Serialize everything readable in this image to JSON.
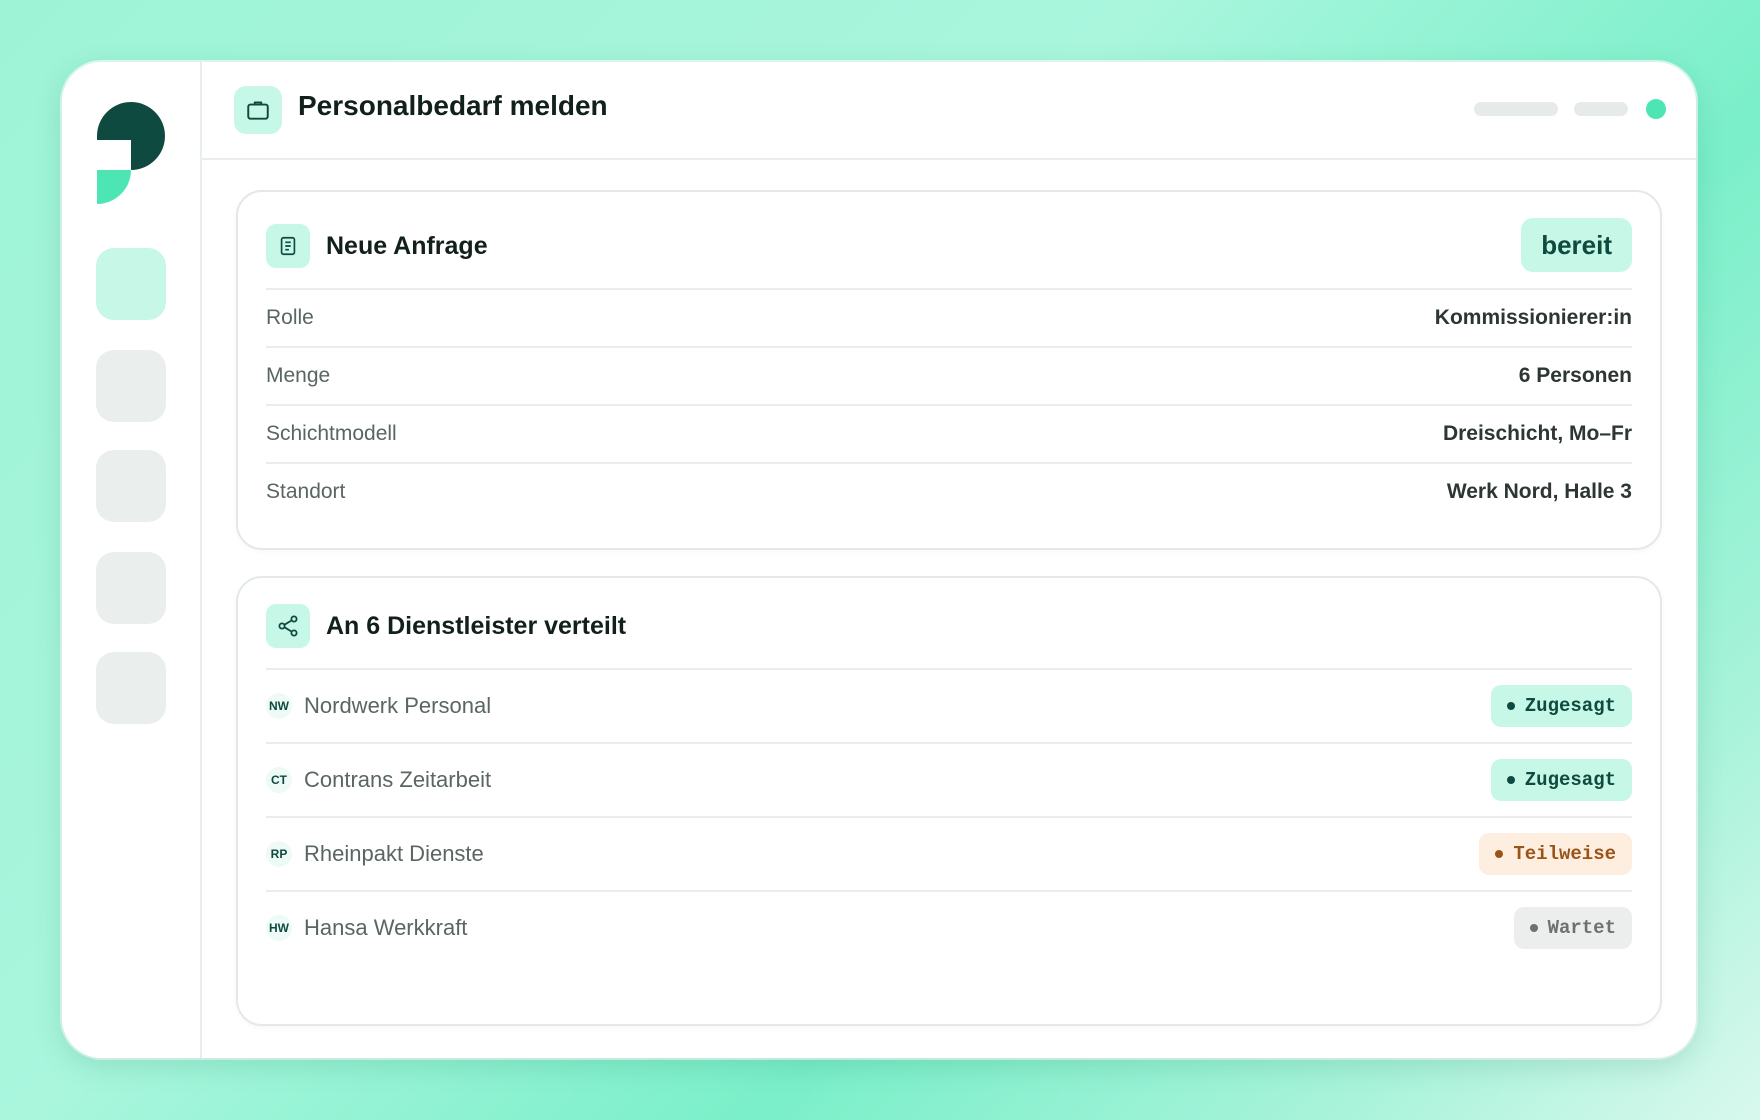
{
  "header": {
    "title": "Personalbedarf melden",
    "icon": "briefcase-icon"
  },
  "request_card": {
    "title": "Neue Anfrage",
    "icon": "document-icon",
    "status": "bereit",
    "fields": [
      {
        "label": "Rolle",
        "value": "Kommissionierer:in"
      },
      {
        "label": "Menge",
        "value": "6 Personen"
      },
      {
        "label": "Schichtmodell",
        "value": "Dreischicht, Mo–Fr"
      },
      {
        "label": "Standort",
        "value": "Werk Nord, Halle 3"
      }
    ]
  },
  "distribution_card": {
    "title": "An 6 Dienstleister verteilt",
    "icon": "share-icon",
    "vendors": [
      {
        "abbr": "NW",
        "name": "Nordwerk Personal",
        "status": "Zugesagt",
        "tone": "green"
      },
      {
        "abbr": "CT",
        "name": "Contrans Zeitarbeit",
        "status": "Zugesagt",
        "tone": "green"
      },
      {
        "abbr": "RP",
        "name": "Rheinpakt Dienste",
        "status": "Teilweise",
        "tone": "orange"
      },
      {
        "abbr": "HW",
        "name": "Hansa Werkkraft",
        "status": "Wartet",
        "tone": "gray"
      }
    ]
  },
  "colors": {
    "accent": "#4ee5b5",
    "accent_soft": "#c7f7e6",
    "brand_dark": "#0e4a3f",
    "warning": "#9a5418"
  }
}
